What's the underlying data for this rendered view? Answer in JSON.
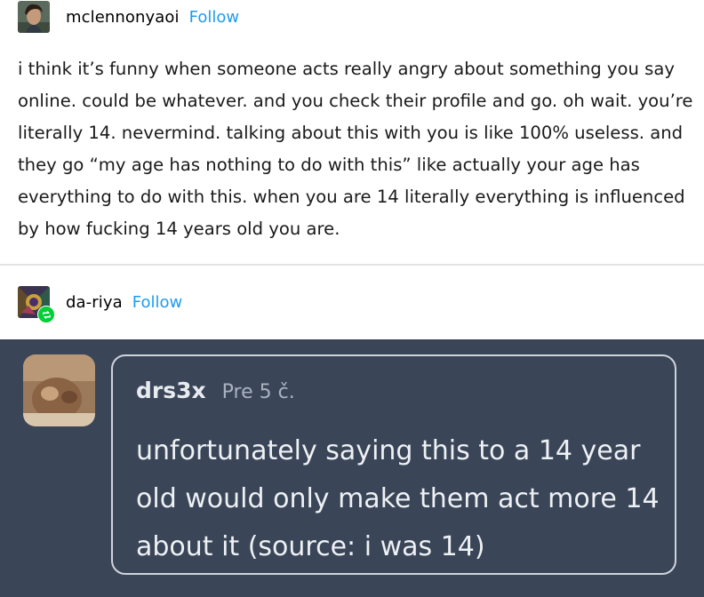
{
  "posts": [
    {
      "username": "mclennonyaoi",
      "follow_label": "Follow",
      "body": "i think it’s funny when someone acts really angry about something you say online. could be whatever. and you check their profile and go. oh wait. you’re literally 14. nevermind. talking about this with you is like 100% useless. and they go “my age has nothing to do with this” like actually your age has everything to do with this. when you are 14 literally everything is influenced by how fucking 14 years old you are."
    },
    {
      "username": "da-riya",
      "follow_label": "Follow",
      "reblog_icon": "reblog-icon"
    }
  ],
  "comment": {
    "author": "drs3x",
    "time": "Pre 5 č.",
    "text": "unfortunately saying this to a 14 year old would only make them act more 14 about it (source: i was 14)"
  },
  "colors": {
    "follow": "#1d9bf0",
    "panel_bg": "#3a4558",
    "reblog_badge": "#00cf35"
  }
}
